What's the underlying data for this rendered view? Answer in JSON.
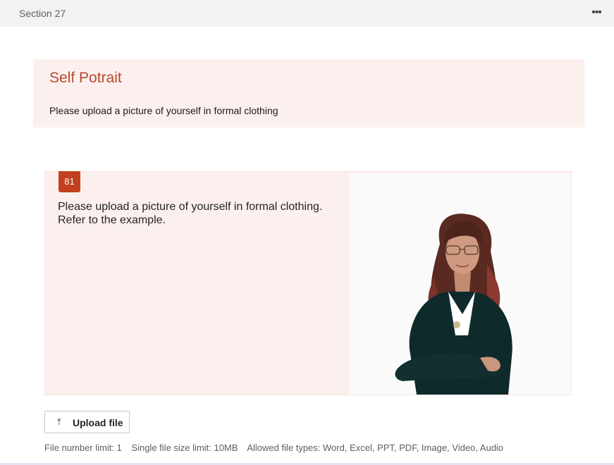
{
  "section": {
    "title": "Section 27",
    "more_icon": "more-horizontal-icon",
    "more_glyph": "•••"
  },
  "header": {
    "title": "Self Potrait",
    "description": "Please upload a picture of yourself in formal clothing"
  },
  "question": {
    "number": "81",
    "text_line1": "Please upload a picture of yourself in formal clothing.",
    "text_line2": "Refer to the example."
  },
  "upload": {
    "icon": "upload-arrow-icon",
    "icon_glyph": "⤒",
    "label": "Upload file"
  },
  "limits": {
    "file_number": "File number limit: 1",
    "file_size": "Single file size limit: 10MB",
    "file_types": "Allowed file types: Word, Excel, PPT, PDF, Image, Video, Audio"
  },
  "colors": {
    "accent": "#c2401f",
    "title": "#b8472d",
    "card_background": "#fcf0ee"
  }
}
